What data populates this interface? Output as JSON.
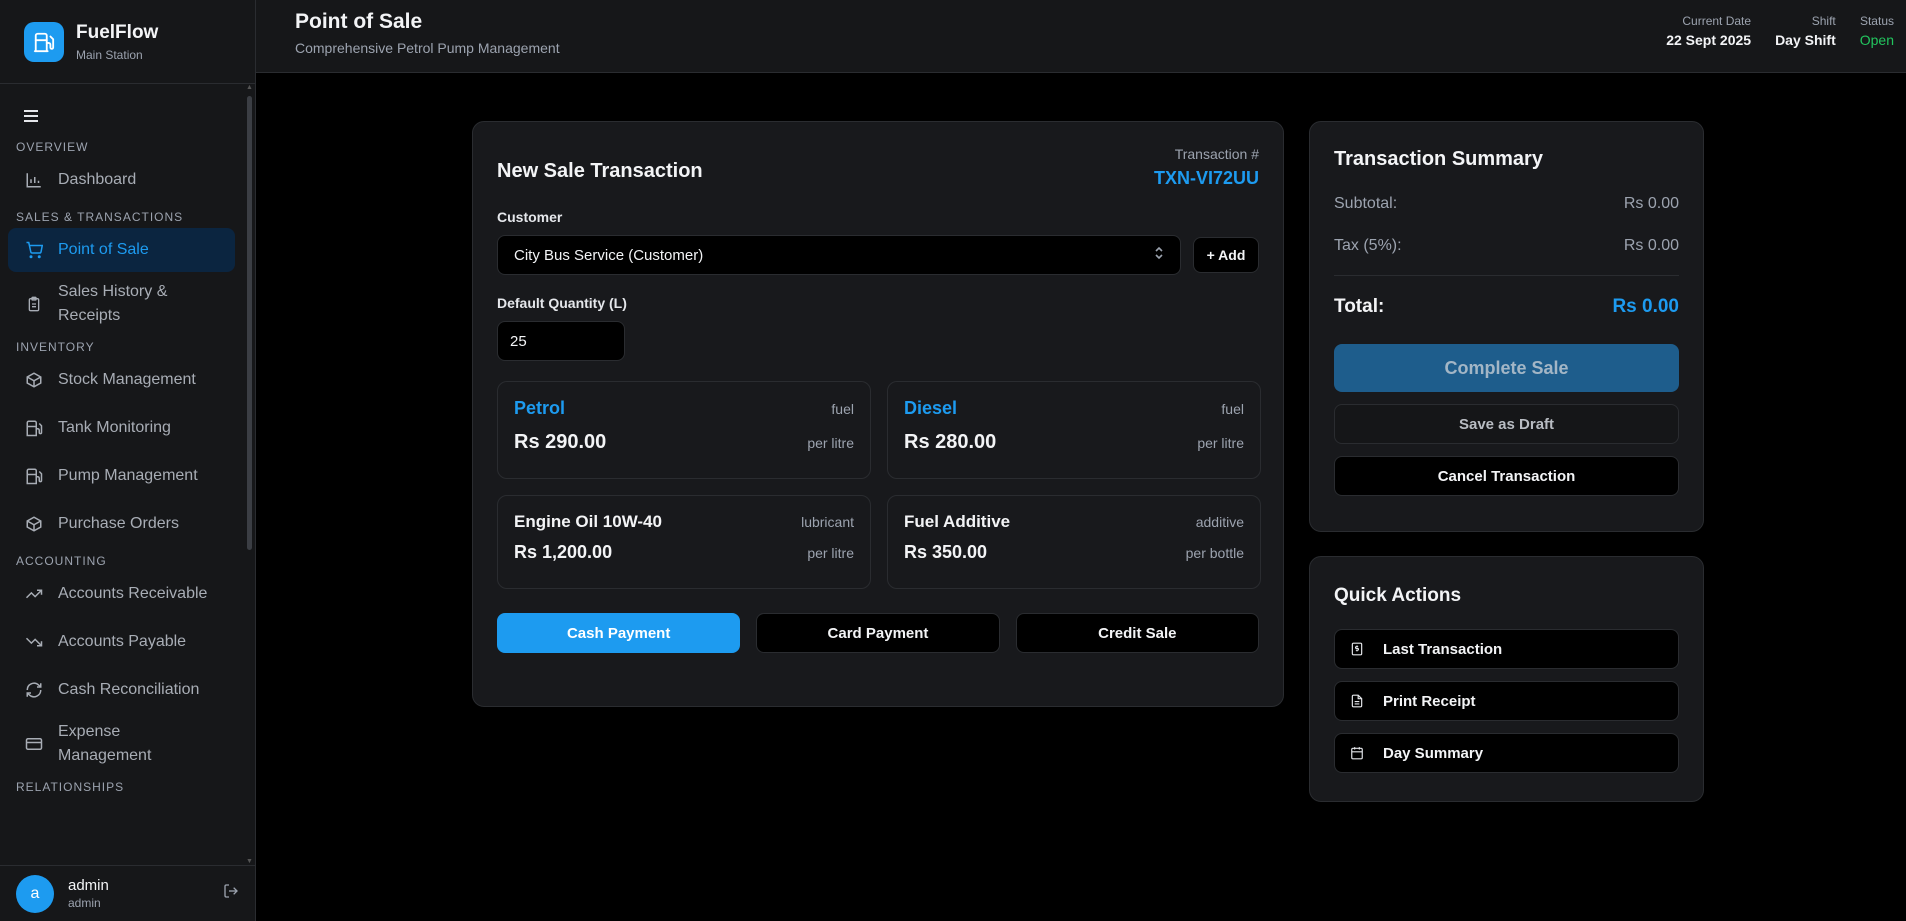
{
  "brand": {
    "name": "FuelFlow",
    "subtitle": "Main Station",
    "logo_icon": "fuel-pump-icon",
    "accent": "#1d9bf0"
  },
  "sidebar": {
    "sections": [
      {
        "label": "OVERVIEW",
        "items": [
          {
            "label": "Dashboard",
            "icon": "bar-chart-icon"
          }
        ]
      },
      {
        "label": "SALES & TRANSACTIONS",
        "items": [
          {
            "label": "Point of Sale",
            "icon": "cart-icon",
            "active": true
          },
          {
            "label": "Sales History & Receipts",
            "icon": "clipboard-icon"
          }
        ]
      },
      {
        "label": "INVENTORY",
        "items": [
          {
            "label": "Stock Management",
            "icon": "package-icon"
          },
          {
            "label": "Tank Monitoring",
            "icon": "fuel-icon"
          },
          {
            "label": "Pump Management",
            "icon": "fuel-icon"
          },
          {
            "label": "Purchase Orders",
            "icon": "package-icon"
          }
        ]
      },
      {
        "label": "ACCOUNTING",
        "items": [
          {
            "label": "Accounts Receivable",
            "icon": "trending-up-icon"
          },
          {
            "label": "Accounts Payable",
            "icon": "trending-down-icon"
          },
          {
            "label": "Cash Reconciliation",
            "icon": "refresh-icon"
          },
          {
            "label": "Expense Management",
            "icon": "credit-card-icon"
          }
        ]
      },
      {
        "label": "RELATIONSHIPS",
        "items": []
      }
    ]
  },
  "user": {
    "initial": "a",
    "name": "admin",
    "role": "admin"
  },
  "header": {
    "title": "Point of Sale",
    "subtitle": "Comprehensive Petrol Pump Management",
    "date_label": "Current Date",
    "date_value": "22 Sept 2025",
    "shift_label": "Shift",
    "shift_value": "Day Shift",
    "status_label": "Status",
    "status_value": "Open",
    "status_color": "#22c55e"
  },
  "sale": {
    "title": "New Sale Transaction",
    "txn_label": "Transaction #",
    "txn_id": "TXN-VI72UU",
    "customer_label": "Customer",
    "customer_value": "City Bus Service (Customer)",
    "add_label": "+ Add",
    "qty_label": "Default Quantity (L)",
    "qty_value": "25",
    "products": [
      {
        "name": "Petrol",
        "type": "fuel",
        "price": "Rs 290.00",
        "unit": "per litre"
      },
      {
        "name": "Diesel",
        "type": "fuel",
        "price": "Rs 280.00",
        "unit": "per litre"
      },
      {
        "name": "Engine Oil 10W-40",
        "type": "lubricant",
        "price": "Rs 1,200.00",
        "unit": "per litre"
      },
      {
        "name": "Fuel Additive",
        "type": "additive",
        "price": "Rs 350.00",
        "unit": "per bottle"
      }
    ],
    "payments": [
      "Cash Payment",
      "Card Payment",
      "Credit Sale"
    ]
  },
  "summary": {
    "title": "Transaction Summary",
    "subtotal_label": "Subtotal:",
    "subtotal_value": "Rs 0.00",
    "tax_label": "Tax (5%):",
    "tax_value": "Rs 0.00",
    "total_label": "Total:",
    "total_value": "Rs 0.00",
    "complete_label": "Complete Sale",
    "draft_label": "Save as Draft",
    "cancel_label": "Cancel Transaction"
  },
  "quick": {
    "title": "Quick Actions",
    "items": [
      {
        "label": "Last Transaction",
        "icon": "receipt-icon"
      },
      {
        "label": "Print Receipt",
        "icon": "document-icon"
      },
      {
        "label": "Day Summary",
        "icon": "calendar-icon"
      }
    ]
  }
}
